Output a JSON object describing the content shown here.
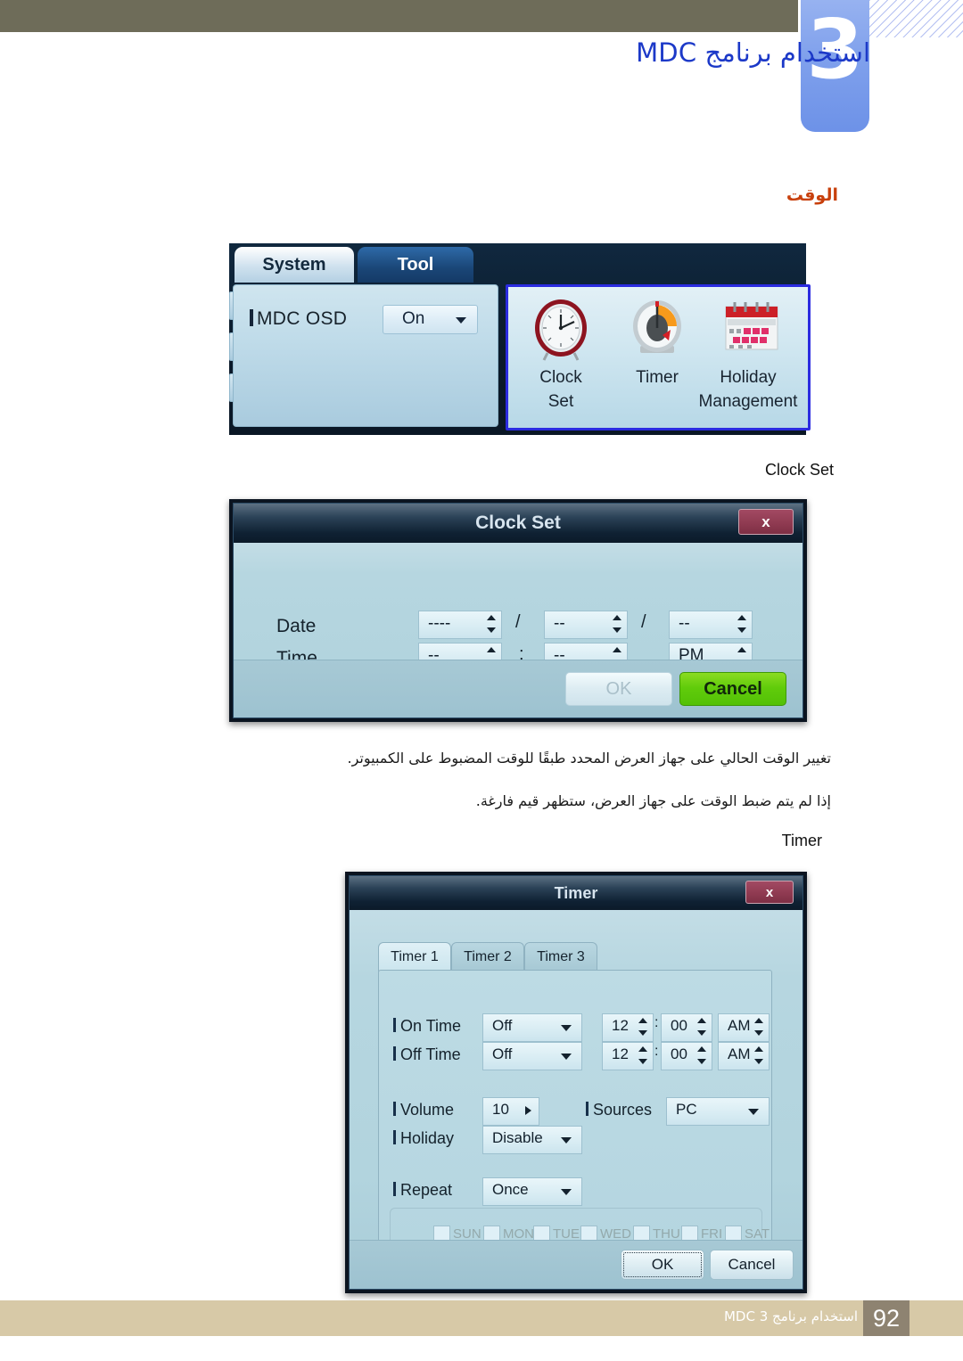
{
  "header": {
    "chapter_number": "3",
    "chapter_title": "استخدام برنامج MDC"
  },
  "section": {
    "heading": "الوقت"
  },
  "osd_panel": {
    "tabs": [
      {
        "label": "System",
        "active": true
      },
      {
        "label": "Tool",
        "active": false
      }
    ],
    "mdc_osd": {
      "label": "MDC OSD",
      "value": "On"
    },
    "icons": [
      {
        "name": "clock-set",
        "label_line1": "Clock",
        "label_line2": "Set"
      },
      {
        "name": "timer",
        "label_line1": "Timer",
        "label_line2": ""
      },
      {
        "name": "holiday-management",
        "label_line1": "Holiday",
        "label_line2": "Management"
      }
    ]
  },
  "clock_set_caption": "Clock Set",
  "clock_set_dialog": {
    "title": "Clock Set",
    "close_label": "x",
    "date_label": "Date",
    "time_label": "Time",
    "date_year": "----",
    "date_month": "--",
    "date_day": "--",
    "date_sep1": "/",
    "date_sep2": "/",
    "time_hour": "--",
    "time_minute": "--",
    "time_meridiem": "PM",
    "time_sep": ":",
    "ok_label": "OK",
    "cancel_label": "Cancel"
  },
  "paragraphs": {
    "p1": "تغيير الوقت الحالي على جهاز العرض المحدد طبقًا للوقت المضبوط على الكمبيوتر.",
    "p2": "إذا لم يتم ضبط الوقت على جهاز العرض، ستظهر قيم فارغة."
  },
  "timer_caption": "Timer",
  "timer_dialog": {
    "title": "Timer",
    "close_label": "x",
    "tabs": [
      {
        "label": "Timer 1",
        "active": true
      },
      {
        "label": "Timer 2",
        "active": false
      },
      {
        "label": "Timer 3",
        "active": false
      }
    ],
    "rows": {
      "on_time": {
        "label": "On Time",
        "mode": "Off",
        "hour": "12",
        "minute": "00",
        "meridiem": "AM",
        "sep": ":"
      },
      "off_time": {
        "label": "Off Time",
        "mode": "Off",
        "hour": "12",
        "minute": "00",
        "meridiem": "AM",
        "sep": ":"
      },
      "volume": {
        "label": "Volume",
        "value": "10"
      },
      "sources": {
        "label": "Sources",
        "value": "PC"
      },
      "holiday": {
        "label": "Holiday",
        "value": "Disable"
      },
      "repeat": {
        "label": "Repeat",
        "value": "Once"
      }
    },
    "days": [
      {
        "label": "SUN",
        "checked": false
      },
      {
        "label": "MON",
        "checked": false
      },
      {
        "label": "TUE",
        "checked": false
      },
      {
        "label": "WED",
        "checked": false
      },
      {
        "label": "THU",
        "checked": false
      },
      {
        "label": "FRI",
        "checked": false
      },
      {
        "label": "SAT",
        "checked": false
      }
    ],
    "ok_label": "OK",
    "cancel_label": "Cancel"
  },
  "footer": {
    "page_number": "92",
    "text": "استخدام برنامج MDC 3"
  },
  "colors": {
    "topbar": "#6e6c59",
    "chapter_tab": "#7fa0ec",
    "chapter_title": "#1c39c8",
    "section_heading": "#c8400c",
    "footer_band": "#d7c9a7",
    "footer_page_bg": "#8e8371",
    "cancel_green": "#61cc0b",
    "close_red": "#8e3950",
    "highlight_border": "#2b2be0"
  }
}
